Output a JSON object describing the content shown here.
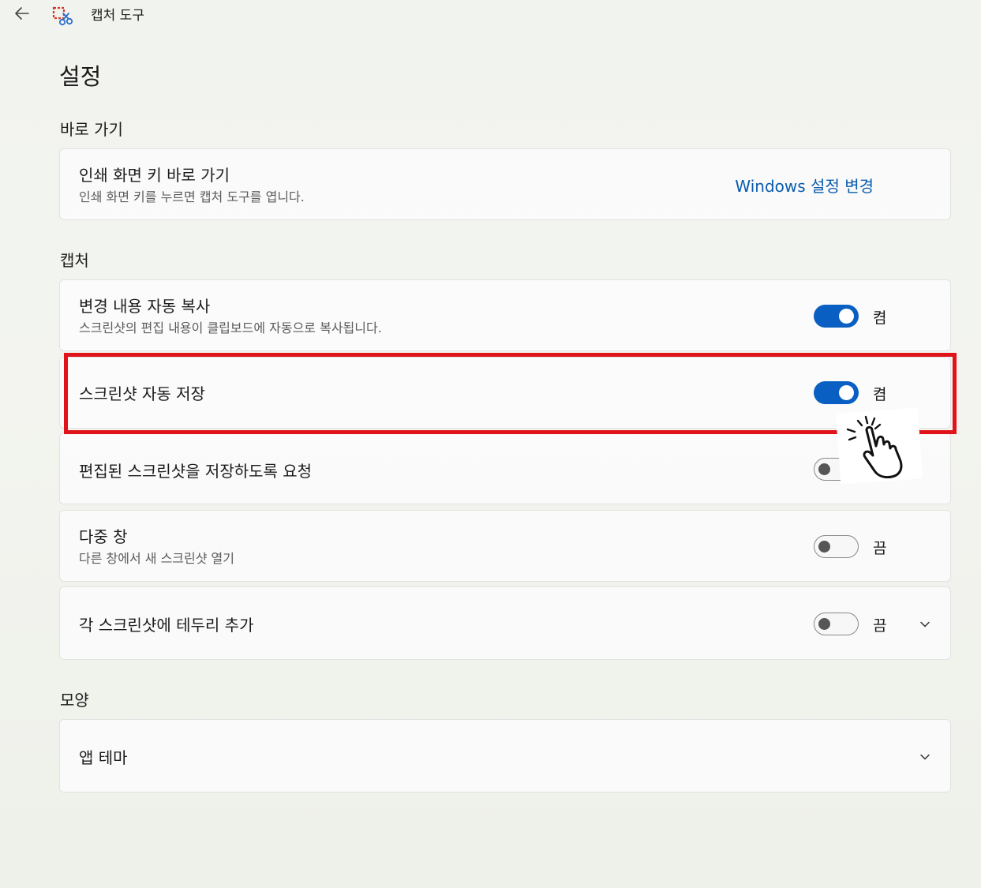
{
  "window": {
    "title": "캡처 도구",
    "back_icon": "arrow-left-icon",
    "app_icon": "snipping-tool-icon"
  },
  "page": {
    "title": "설정"
  },
  "sections": {
    "shortcuts": {
      "header": "바로 가기",
      "print_screen": {
        "title": "인쇄 화면 키 바로 가기",
        "description": "인쇄 화면 키를 누르면 캡처 도구를 엽니다.",
        "link": "Windows 설정 변경"
      }
    },
    "capture": {
      "header": "캡처",
      "items": [
        {
          "title": "변경 내용 자동 복사",
          "description": "스크린샷의 편집 내용이 클립보드에 자동으로 복사됩니다.",
          "state": "켬",
          "on": true
        },
        {
          "title": "스크린샷 자동 저장",
          "state": "켬",
          "on": true
        },
        {
          "title": "편집된 스크린샷을 저장하도록 요청",
          "on": false
        },
        {
          "title": "다중 창",
          "description": "다른 창에서 새 스크린샷 열기",
          "state": "끔",
          "on": false
        },
        {
          "title": "각 스크린샷에 테두리 추가",
          "state": "끔",
          "on": false,
          "expand_icon": "chevron-down-icon"
        }
      ]
    },
    "appearance": {
      "header": "모양",
      "theme": {
        "title": "앱 테마",
        "expand_icon": "chevron-down-icon"
      }
    }
  },
  "annotations": {
    "highlight_color": "#e0121a",
    "pointer_icon": "hand-pointer-click-icon"
  },
  "colors": {
    "accent": "#0a5fc2",
    "link": "#0a5cad"
  }
}
